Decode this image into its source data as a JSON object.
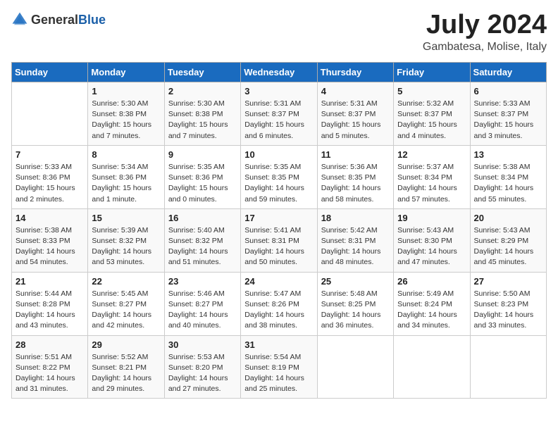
{
  "logo": {
    "general": "General",
    "blue": "Blue"
  },
  "header": {
    "month": "July 2024",
    "location": "Gambatesa, Molise, Italy"
  },
  "days_of_week": [
    "Sunday",
    "Monday",
    "Tuesday",
    "Wednesday",
    "Thursday",
    "Friday",
    "Saturday"
  ],
  "weeks": [
    [
      {
        "day": "",
        "info": ""
      },
      {
        "day": "1",
        "info": "Sunrise: 5:30 AM\nSunset: 8:38 PM\nDaylight: 15 hours\nand 7 minutes."
      },
      {
        "day": "2",
        "info": "Sunrise: 5:30 AM\nSunset: 8:38 PM\nDaylight: 15 hours\nand 7 minutes."
      },
      {
        "day": "3",
        "info": "Sunrise: 5:31 AM\nSunset: 8:37 PM\nDaylight: 15 hours\nand 6 minutes."
      },
      {
        "day": "4",
        "info": "Sunrise: 5:31 AM\nSunset: 8:37 PM\nDaylight: 15 hours\nand 5 minutes."
      },
      {
        "day": "5",
        "info": "Sunrise: 5:32 AM\nSunset: 8:37 PM\nDaylight: 15 hours\nand 4 minutes."
      },
      {
        "day": "6",
        "info": "Sunrise: 5:33 AM\nSunset: 8:37 PM\nDaylight: 15 hours\nand 3 minutes."
      }
    ],
    [
      {
        "day": "7",
        "info": "Sunrise: 5:33 AM\nSunset: 8:36 PM\nDaylight: 15 hours\nand 2 minutes."
      },
      {
        "day": "8",
        "info": "Sunrise: 5:34 AM\nSunset: 8:36 PM\nDaylight: 15 hours\nand 1 minute."
      },
      {
        "day": "9",
        "info": "Sunrise: 5:35 AM\nSunset: 8:36 PM\nDaylight: 15 hours\nand 0 minutes."
      },
      {
        "day": "10",
        "info": "Sunrise: 5:35 AM\nSunset: 8:35 PM\nDaylight: 14 hours\nand 59 minutes."
      },
      {
        "day": "11",
        "info": "Sunrise: 5:36 AM\nSunset: 8:35 PM\nDaylight: 14 hours\nand 58 minutes."
      },
      {
        "day": "12",
        "info": "Sunrise: 5:37 AM\nSunset: 8:34 PM\nDaylight: 14 hours\nand 57 minutes."
      },
      {
        "day": "13",
        "info": "Sunrise: 5:38 AM\nSunset: 8:34 PM\nDaylight: 14 hours\nand 55 minutes."
      }
    ],
    [
      {
        "day": "14",
        "info": "Sunrise: 5:38 AM\nSunset: 8:33 PM\nDaylight: 14 hours\nand 54 minutes."
      },
      {
        "day": "15",
        "info": "Sunrise: 5:39 AM\nSunset: 8:32 PM\nDaylight: 14 hours\nand 53 minutes."
      },
      {
        "day": "16",
        "info": "Sunrise: 5:40 AM\nSunset: 8:32 PM\nDaylight: 14 hours\nand 51 minutes."
      },
      {
        "day": "17",
        "info": "Sunrise: 5:41 AM\nSunset: 8:31 PM\nDaylight: 14 hours\nand 50 minutes."
      },
      {
        "day": "18",
        "info": "Sunrise: 5:42 AM\nSunset: 8:31 PM\nDaylight: 14 hours\nand 48 minutes."
      },
      {
        "day": "19",
        "info": "Sunrise: 5:43 AM\nSunset: 8:30 PM\nDaylight: 14 hours\nand 47 minutes."
      },
      {
        "day": "20",
        "info": "Sunrise: 5:43 AM\nSunset: 8:29 PM\nDaylight: 14 hours\nand 45 minutes."
      }
    ],
    [
      {
        "day": "21",
        "info": "Sunrise: 5:44 AM\nSunset: 8:28 PM\nDaylight: 14 hours\nand 43 minutes."
      },
      {
        "day": "22",
        "info": "Sunrise: 5:45 AM\nSunset: 8:27 PM\nDaylight: 14 hours\nand 42 minutes."
      },
      {
        "day": "23",
        "info": "Sunrise: 5:46 AM\nSunset: 8:27 PM\nDaylight: 14 hours\nand 40 minutes."
      },
      {
        "day": "24",
        "info": "Sunrise: 5:47 AM\nSunset: 8:26 PM\nDaylight: 14 hours\nand 38 minutes."
      },
      {
        "day": "25",
        "info": "Sunrise: 5:48 AM\nSunset: 8:25 PM\nDaylight: 14 hours\nand 36 minutes."
      },
      {
        "day": "26",
        "info": "Sunrise: 5:49 AM\nSunset: 8:24 PM\nDaylight: 14 hours\nand 34 minutes."
      },
      {
        "day": "27",
        "info": "Sunrise: 5:50 AM\nSunset: 8:23 PM\nDaylight: 14 hours\nand 33 minutes."
      }
    ],
    [
      {
        "day": "28",
        "info": "Sunrise: 5:51 AM\nSunset: 8:22 PM\nDaylight: 14 hours\nand 31 minutes."
      },
      {
        "day": "29",
        "info": "Sunrise: 5:52 AM\nSunset: 8:21 PM\nDaylight: 14 hours\nand 29 minutes."
      },
      {
        "day": "30",
        "info": "Sunrise: 5:53 AM\nSunset: 8:20 PM\nDaylight: 14 hours\nand 27 minutes."
      },
      {
        "day": "31",
        "info": "Sunrise: 5:54 AM\nSunset: 8:19 PM\nDaylight: 14 hours\nand 25 minutes."
      },
      {
        "day": "",
        "info": ""
      },
      {
        "day": "",
        "info": ""
      },
      {
        "day": "",
        "info": ""
      }
    ]
  ]
}
